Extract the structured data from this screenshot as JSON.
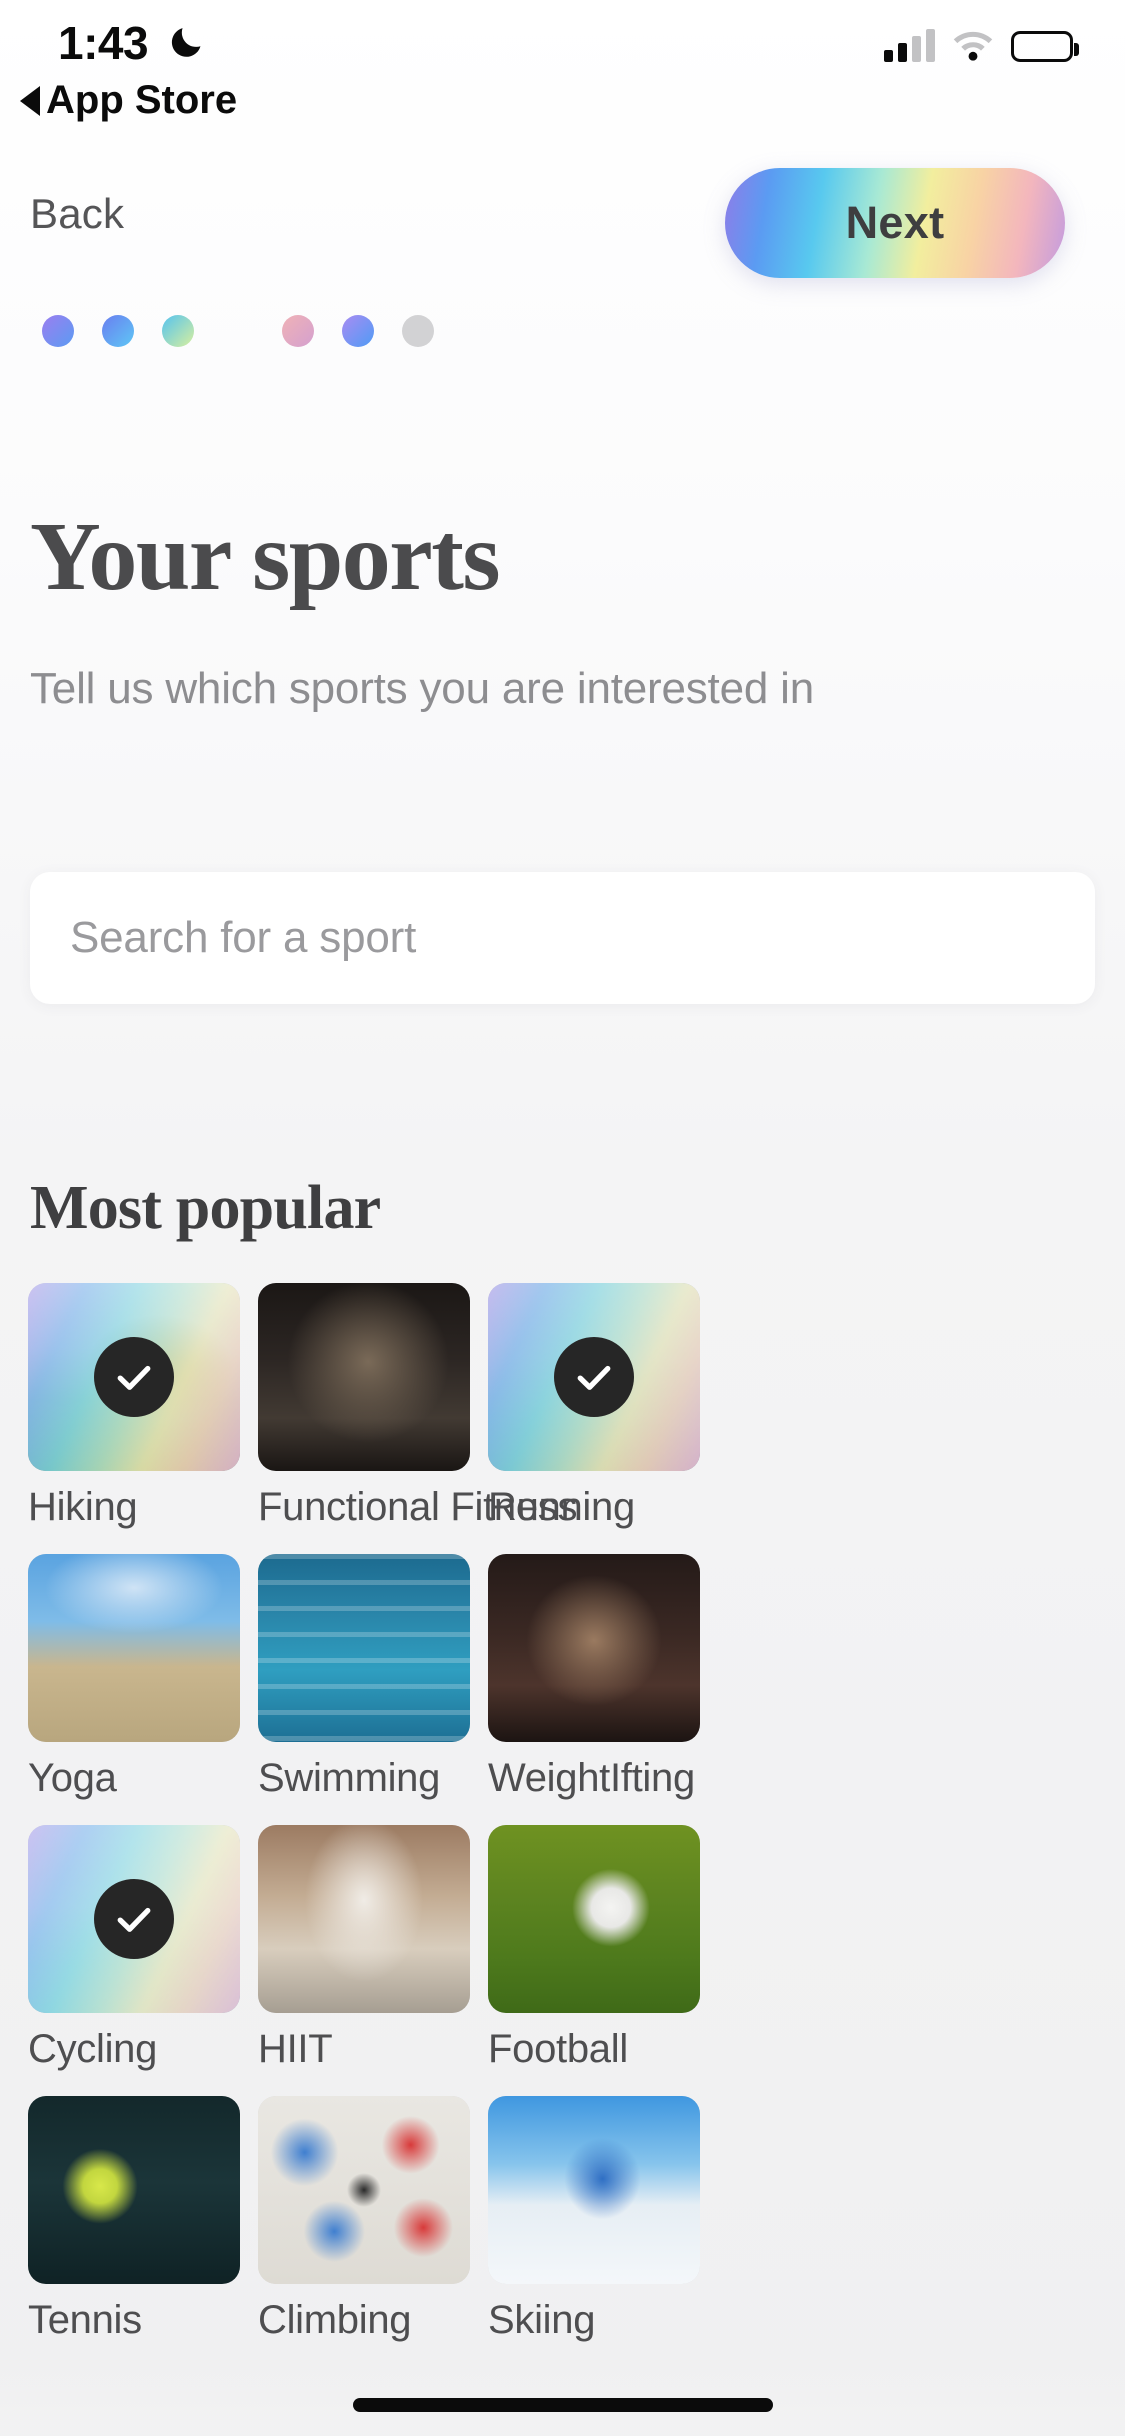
{
  "status_bar": {
    "time": "1:43",
    "dnd_icon": "moon-icon",
    "return_label": "App Store",
    "return_icon": "back-triangle-icon",
    "cellular_icon": "cellular-signal-icon",
    "wifi_icon": "wifi-icon",
    "battery_icon": "battery-full-icon"
  },
  "nav": {
    "back_label": "Back",
    "next_label": "Next"
  },
  "progress": {
    "total": 7,
    "current": 6,
    "dots": [
      {
        "index": 1,
        "active": true,
        "color_from": "#9b7ef0",
        "color_to": "#5b9bf2"
      },
      {
        "index": 2,
        "active": true,
        "color_from": "#6a7ef0",
        "color_to": "#5ec7f5"
      },
      {
        "index": 3,
        "active": true,
        "color_from": "#55c3ef",
        "color_to": "#d8ef9e"
      },
      {
        "index": 4,
        "active": true,
        "color_from": "# efe6a6",
        "color_to": "#f6c99a"
      },
      {
        "index": 5,
        "active": true,
        "color_from": "#f0b2b6",
        "color_to": "#d4a0cf"
      },
      {
        "index": 6,
        "active": true,
        "color_from": "#a98cf2",
        "color_to": "#4f9bf5"
      },
      {
        "index": 7,
        "active": false,
        "color_from": "#d2d2d4",
        "color_to": "#d2d2d4"
      }
    ]
  },
  "header": {
    "title": "Your sports",
    "subtitle": "Tell us which sports you are interested in"
  },
  "search": {
    "placeholder": "Search for a sport",
    "value": "",
    "icon": "search-icon"
  },
  "section": {
    "title": "Most popular"
  },
  "sports": [
    {
      "label": "Hiking",
      "selected": true,
      "photo": "ph-hiking"
    },
    {
      "label": "Functional Fitness",
      "selected": false,
      "photo": "ph-functional"
    },
    {
      "label": "Running",
      "selected": true,
      "photo": "ph-running"
    },
    {
      "label": "Yoga",
      "selected": false,
      "photo": "ph-yoga"
    },
    {
      "label": "Swimming",
      "selected": false,
      "photo": "ph-swimming"
    },
    {
      "label": "WeightIfting",
      "selected": false,
      "photo": "ph-weight"
    },
    {
      "label": "Cycling",
      "selected": true,
      "photo": "ph-cycling"
    },
    {
      "label": "HIIT",
      "selected": false,
      "photo": "ph-hiit"
    },
    {
      "label": "Football",
      "selected": false,
      "photo": "ph-football"
    },
    {
      "label": "Tennis",
      "selected": false,
      "photo": "ph-tennis"
    },
    {
      "label": "Climbing",
      "selected": false,
      "photo": "ph-climbing"
    },
    {
      "label": "Skiing",
      "selected": false,
      "photo": "ph-skiing"
    }
  ],
  "selection_badge": {
    "icon": "checkmark-icon",
    "background": "#262626",
    "tick_color": "#ffffff"
  },
  "theme": {
    "page_background": "#f2f2f3",
    "title_color": "#4b4b4d",
    "subtitle_color": "#8d8d90",
    "label_color": "#4e4e50",
    "card_surface": "#ffffff"
  },
  "home_indicator": "home-indicator-bar"
}
